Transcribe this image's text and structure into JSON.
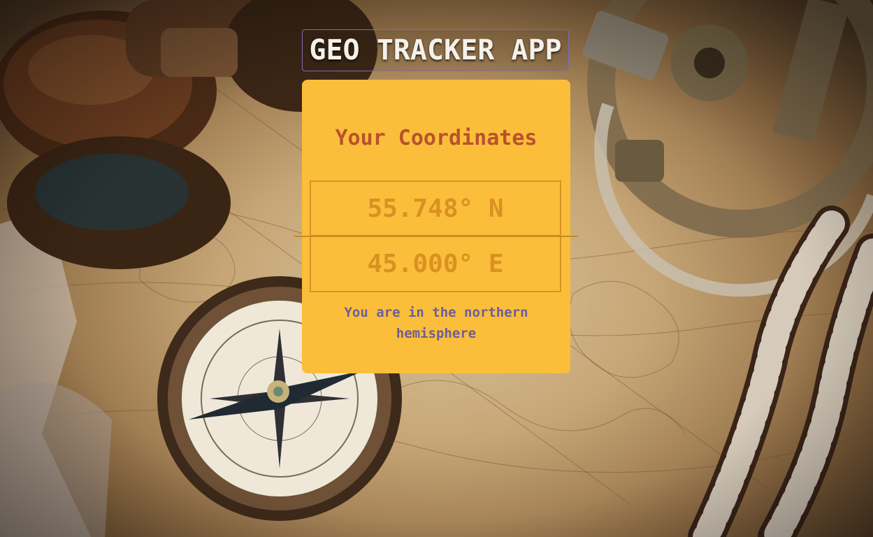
{
  "app": {
    "title": "GEO TRACKER APP"
  },
  "card": {
    "heading": "Your Coordinates",
    "latitude": "55.748° N",
    "longitude": "45.000° E",
    "hemisphere_message": "You are in the northern hemisphere"
  },
  "colors": {
    "card_background": "#fbbe3a",
    "heading_text": "#b8522c",
    "coordinate_text": "#d99123",
    "message_text": "#6b5e9c",
    "title_text": "#f4f1ea",
    "title_border": "#7d6bb0"
  }
}
